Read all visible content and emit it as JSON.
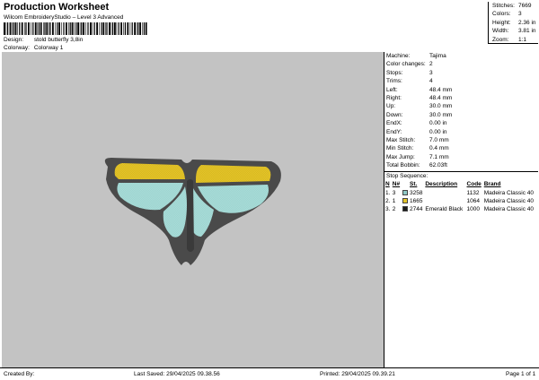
{
  "header": {
    "title": "Production Worksheet",
    "subtitle": "Wilcom EmbroideryStudio – Level 3 Advanced",
    "design_label": "Design:",
    "design_value": "stold butterfly 3,8in",
    "colorway_label": "Colorway:",
    "colorway_value": "Colorway 1"
  },
  "stats": [
    {
      "label": "Stitches:",
      "value": "7669"
    },
    {
      "label": "Colors:",
      "value": "3"
    },
    {
      "label": "Height:",
      "value": "2.36 in"
    },
    {
      "label": "Width:",
      "value": "3.81 in"
    },
    {
      "label": "Zoom:",
      "value": "1:1"
    }
  ],
  "properties": [
    {
      "label": "Machine:",
      "value": "Tajima"
    },
    {
      "label": "Color changes:",
      "value": "2"
    },
    {
      "label": "Stops:",
      "value": "3"
    },
    {
      "label": "Trims:",
      "value": "4"
    },
    {
      "label": "Left:",
      "value": "48.4 mm"
    },
    {
      "label": "Right:",
      "value": "48.4 mm"
    },
    {
      "label": "Up:",
      "value": "30.0 mm"
    },
    {
      "label": "Down:",
      "value": "30.0 mm"
    },
    {
      "label": "EndX:",
      "value": "0.00 in"
    },
    {
      "label": "EndY:",
      "value": "0.00 in"
    },
    {
      "label": "Max Stitch:",
      "value": "7.0 mm"
    },
    {
      "label": "Min Stitch:",
      "value": "0.4 mm"
    },
    {
      "label": "Max Jump:",
      "value": "7.1 mm"
    },
    {
      "label": "Total Bobbin:",
      "value": "62.03ft"
    }
  ],
  "stop_sequence": {
    "title": "Stop Sequence:",
    "headers": [
      "N",
      "N#",
      "St.",
      "Description",
      "Code",
      "Brand"
    ],
    "rows": [
      {
        "n": "1.",
        "num": "3",
        "color": "#8fc9c6",
        "st": "3258",
        "desc": "",
        "code": "1132",
        "brand": "Madeira Classic 40"
      },
      {
        "n": "2.",
        "num": "1",
        "color": "#e3c42a",
        "st": "1665",
        "desc": "",
        "code": "1064",
        "brand": "Madeira Classic 40"
      },
      {
        "n": "3.",
        "num": "2",
        "color": "#1b1b1b",
        "st": "2744",
        "desc": "Emerald Black",
        "code": "1000",
        "brand": "Madeira Classic 40"
      }
    ]
  },
  "footer": {
    "created": "Created By:",
    "saved": "Last Saved: 29/04/2025 09.38.56",
    "printed": "Printed: 29/04/2025 09.39.21",
    "page": "Page 1 of 1"
  },
  "colors": {
    "canvas_bg": "#c3c3c3",
    "outline": "#4a4a4a",
    "yellow": "#e3c42a",
    "teal": "#a8dcd8"
  }
}
